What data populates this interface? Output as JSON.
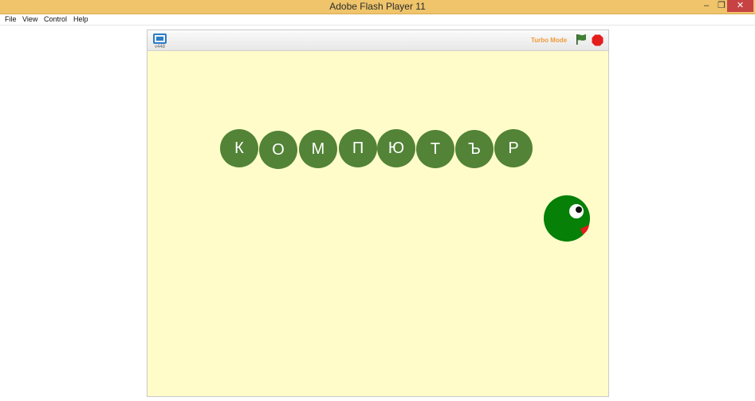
{
  "window": {
    "title": "Adobe Flash Player 11",
    "minimize_glyph": "–",
    "restore_glyph": "❐",
    "close_glyph": "✕"
  },
  "menu": {
    "items": [
      {
        "label": "File"
      },
      {
        "label": "View"
      },
      {
        "label": "Control"
      },
      {
        "label": "Help"
      }
    ]
  },
  "player": {
    "version": "v448",
    "turbo_label": "Turbo Mode",
    "colors": {
      "stage_background": "#fffcc9",
      "turbo": "#f09a3a",
      "flag": "#3f7f34",
      "stop": "#e41c1c",
      "letter_bubble": "#528336",
      "snake_head": "#068007",
      "tongue": "#e41c1c"
    },
    "icons": {
      "fullscreen": "fullscreen-icon",
      "green_flag": "green-flag-icon",
      "stop": "stop-icon"
    }
  },
  "stage": {
    "letters": [
      "К",
      "О",
      "М",
      "П",
      "Ю",
      "Т",
      "Ъ",
      "Р"
    ]
  }
}
